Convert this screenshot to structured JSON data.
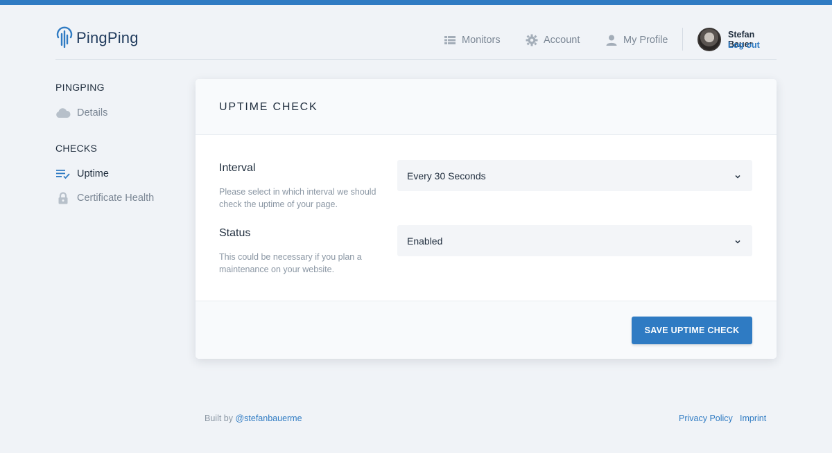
{
  "brand": {
    "name": "PingPing",
    "accent": "#2f7bc3",
    "logo_icon": "ping-signal-icon"
  },
  "nav": {
    "monitors": {
      "label": "Monitors",
      "icon": "list-grid-icon"
    },
    "account": {
      "label": "Account",
      "icon": "gear-icon"
    },
    "profile": {
      "label": "My Profile",
      "icon": "user-icon"
    }
  },
  "user": {
    "name": "Stefan Bauer",
    "logout": "Log out"
  },
  "sidebar": {
    "section1": {
      "title": "PINGPING",
      "items": [
        {
          "label": "Details",
          "icon": "cloud-icon"
        }
      ]
    },
    "section2": {
      "title": "CHECKS",
      "items": [
        {
          "label": "Uptime",
          "icon": "checklist-icon",
          "active": true
        },
        {
          "label": "Certificate Health",
          "icon": "lock-icon"
        }
      ]
    }
  },
  "card": {
    "title": "UPTIME CHECK",
    "fields": [
      {
        "label": "Interval",
        "help": "Please select in which interval we should check the uptime of your page.",
        "value": "Every 30 Seconds"
      },
      {
        "label": "Status",
        "help": "This could be necessary if you plan a maintenance on your website.",
        "value": "Enabled"
      }
    ],
    "save_label": "SAVE UPTIME CHECK"
  },
  "footer": {
    "built_by_prefix": "Built by ",
    "built_by_handle": "@stefanbauerme",
    "privacy": "Privacy Policy",
    "imprint": "Imprint"
  }
}
